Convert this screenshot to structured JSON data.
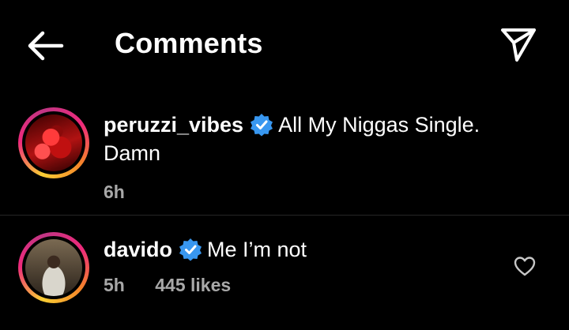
{
  "header": {
    "title": "Comments",
    "back_icon": "arrow-left-icon",
    "send_icon": "paper-plane-icon"
  },
  "comments": [
    {
      "username": "peruzzi_vibes",
      "verified": true,
      "text": "All My Niggas Single. Damn",
      "time": "6h",
      "likes": ""
    },
    {
      "username": "davido",
      "verified": true,
      "text": "Me I’m not",
      "time": "5h",
      "likes": "445 likes"
    }
  ],
  "colors": {
    "background": "#000000",
    "text": "#ffffff",
    "muted": "#a8a8a8",
    "verified_blue": "#3897f0"
  }
}
